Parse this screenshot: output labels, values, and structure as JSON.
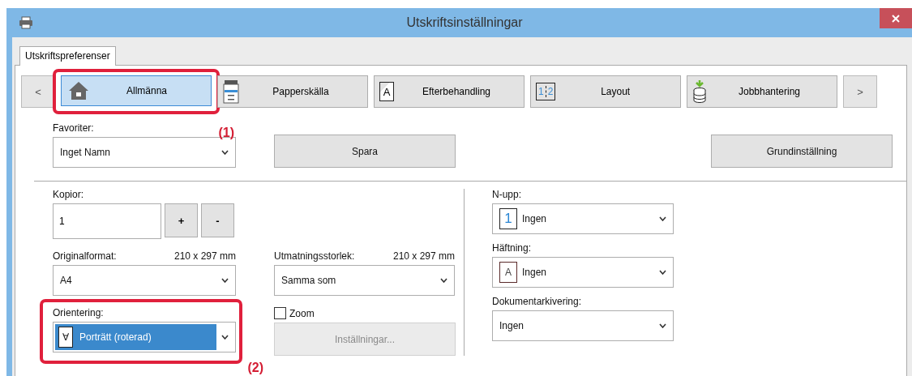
{
  "window": {
    "title": "Utskriftsinställningar"
  },
  "tabs": [
    {
      "label": "Utskriftspreferenser",
      "selected": true
    }
  ],
  "categories": {
    "prev": "<",
    "next": ">",
    "items": [
      {
        "label": "Allmänna",
        "kind": "home",
        "selected": true,
        "callout": "(1)"
      },
      {
        "label": "Papperskälla",
        "kind": "printer",
        "selected": false
      },
      {
        "label": "Efterbehandling",
        "kind": "page",
        "icon_text": "A",
        "selected": false
      },
      {
        "label": "Layout",
        "kind": "split",
        "icon_text": "1",
        "icon_text_2": "2",
        "selected": false
      },
      {
        "label": "Jobbhantering",
        "kind": "stack",
        "selected": false
      }
    ]
  },
  "favorites": {
    "label": "Favoriter:",
    "value": "Inget Namn",
    "save": "Spara",
    "defaults": "Grundinställning"
  },
  "copies": {
    "label": "Kopior:",
    "value": "1",
    "plus": "+",
    "minus": "-"
  },
  "original_size": {
    "label": "Originalformat:",
    "dimensions": "210 x 297 mm",
    "value": "A4"
  },
  "output_size": {
    "label": "Utmatningsstorlek:",
    "dimensions": "210 x 297 mm",
    "value": "Samma som"
  },
  "orientation": {
    "label": "Orientering:",
    "icon_text": "∀",
    "value": "Porträtt (roterad)",
    "highlighted": true,
    "callout": "(2)"
  },
  "zoom": {
    "label": "Zoom",
    "checked": false,
    "button": "Inställningar...",
    "disabled": true
  },
  "right_fields": [
    {
      "label": "N-upp:",
      "kind": "number",
      "icon_text": "1",
      "value": "Ingen"
    },
    {
      "label": "Häftning:",
      "kind": "letter",
      "icon_text": "A",
      "value": "Ingen"
    },
    {
      "label": "Dokumentarkivering:",
      "value": "Ingen"
    }
  ]
}
